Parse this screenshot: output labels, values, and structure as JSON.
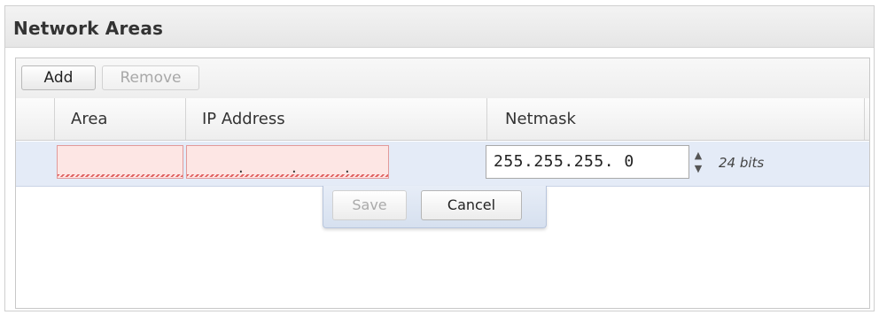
{
  "panel": {
    "title": "Network Areas"
  },
  "toolbar": {
    "add_label": "Add",
    "remove_label": "Remove"
  },
  "columns": {
    "area": "Area",
    "ip": "IP Address",
    "netmask": "Netmask"
  },
  "edit_row": {
    "area_value": "",
    "ip_dots": [
      ".",
      ".",
      "."
    ],
    "netmask_value": "255.255.255. 0",
    "netmask_bits": "24 bits"
  },
  "actions": {
    "save_label": "Save",
    "cancel_label": "Cancel"
  },
  "icons": {
    "spinner_up": "chevron-up-icon",
    "spinner_down": "chevron-down-icon"
  },
  "colors": {
    "invalid_fill": "#fde6e4",
    "selected_row": "#e4ebf7"
  }
}
